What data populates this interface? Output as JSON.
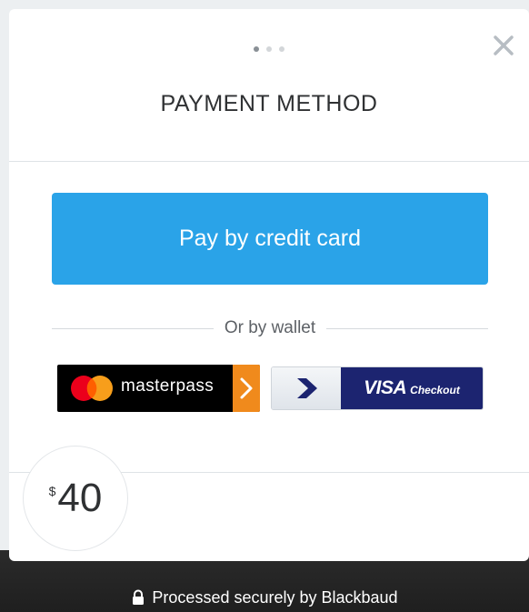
{
  "modal": {
    "title": "PAYMENT METHOD",
    "steps": {
      "total": 3,
      "active": 1
    },
    "close_icon": "close-icon"
  },
  "payment": {
    "credit_card_label": "Pay by credit card",
    "wallet_divider": "Or by wallet",
    "masterpass_label": "masterpass",
    "visa_label": "VISA",
    "visa_checkout_label": "Checkout"
  },
  "amount": {
    "currency": "$",
    "value": "40"
  },
  "footer": {
    "text": "Processed securely by Blackbaud",
    "icon": "lock-icon"
  },
  "colors": {
    "primary_button": "#2aa3e8",
    "masterpass_orange": "#f08a1c",
    "visa_navy": "#1c2470"
  }
}
